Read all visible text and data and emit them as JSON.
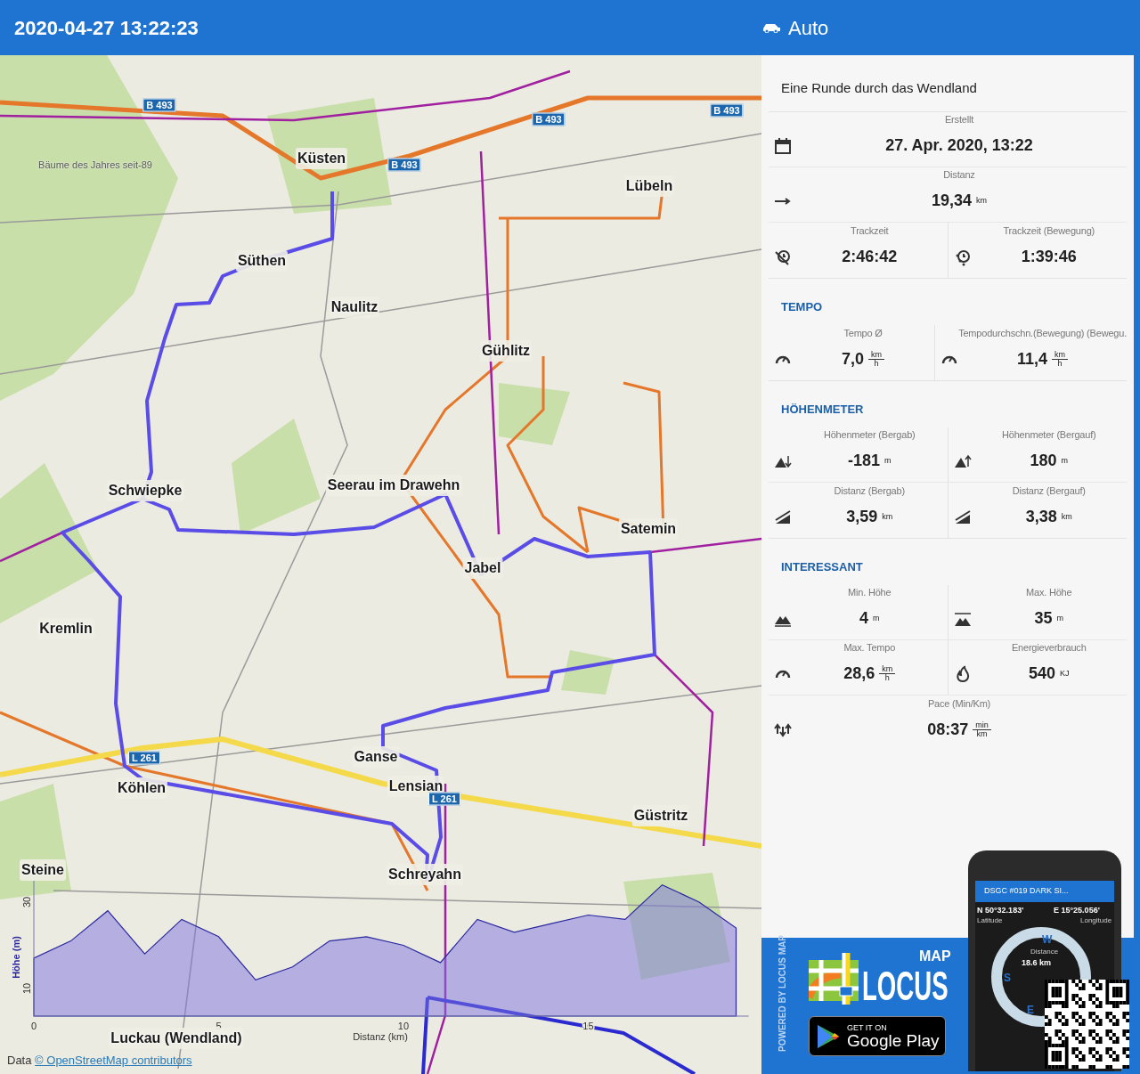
{
  "header": {
    "timestamp": "2020-04-27 13:22:23",
    "activity": "Auto"
  },
  "map": {
    "places": [
      {
        "text": "Küsten",
        "kind": "place"
      },
      {
        "text": "Lübeln",
        "kind": "place"
      },
      {
        "text": "Süthen",
        "kind": "place"
      },
      {
        "text": "Naulitz",
        "kind": "place"
      },
      {
        "text": "Gühlitz",
        "kind": "place"
      },
      {
        "text": "Schwiepke",
        "kind": "place"
      },
      {
        "text": "Seerau im Drawehn",
        "kind": "place"
      },
      {
        "text": "Jabel",
        "kind": "place"
      },
      {
        "text": "Satemin",
        "kind": "place"
      },
      {
        "text": "Kremlin",
        "kind": "place"
      },
      {
        "text": "Ganse",
        "kind": "place"
      },
      {
        "text": "Lensian",
        "kind": "place"
      },
      {
        "text": "Köhlen",
        "kind": "place"
      },
      {
        "text": "Güstritz",
        "kind": "place"
      },
      {
        "text": "Steine",
        "kind": "place"
      },
      {
        "text": "Schreyahn",
        "kind": "place"
      },
      {
        "text": "Luckau (Wendland)",
        "kind": "place"
      },
      {
        "text": "B 493",
        "kind": "road"
      },
      {
        "text": "B 493",
        "kind": "road"
      },
      {
        "text": "B 493",
        "kind": "road"
      },
      {
        "text": "B 493",
        "kind": "road"
      },
      {
        "text": "L 261",
        "kind": "road"
      },
      {
        "text": "L 261",
        "kind": "road"
      },
      {
        "text": "Bäume des Jahres seit-89",
        "kind": "note"
      }
    ],
    "attribution": {
      "prefix": "Data",
      "link": "© OpenStreetMap contributors"
    },
    "chart_data": {
      "type": "area",
      "xlabel": "Distanz (km)",
      "ylabel": "Höhe (m)",
      "x": [
        0,
        1,
        2,
        3,
        4,
        5,
        6,
        7,
        8,
        9,
        10,
        11,
        12,
        13,
        14,
        15,
        16,
        17,
        18,
        19
      ],
      "series": [
        {
          "color": "#7b74e0",
          "values": [
            17,
            21,
            28,
            18,
            26,
            22,
            12,
            15,
            21,
            22,
            20,
            16,
            26,
            23,
            25,
            27,
            26,
            34,
            30,
            24
          ]
        }
      ],
      "xlim": [
        0,
        19.34
      ],
      "ylim": [
        3.6,
        35
      ],
      "xticks": [
        0,
        5,
        10,
        15
      ],
      "yticks": [
        10,
        30
      ]
    }
  },
  "track": {
    "name": "Eine Runde durch das Wendland",
    "sections": [
      {
        "rows": [
          [
            {
              "label": "Erstellt",
              "value": "27. Apr. 2020, 13:22"
            }
          ],
          [
            {
              "label": "Distanz",
              "value": "19,34",
              "unit": "km"
            }
          ],
          [
            {
              "label": "Trackzeit",
              "value": "2:46:42"
            },
            {
              "label": "Trackzeit (Bewegung)",
              "value": "1:39:46"
            }
          ]
        ]
      },
      {
        "heading": "TEMPO",
        "rows": [
          [
            {
              "label": "Tempo Ø",
              "value": "7,0",
              "unit_over": "km",
              "unit_under": "h"
            },
            {
              "label": "Tempodurchschn.(Bewegung) (Bewegu.",
              "value": "11,4",
              "unit_over": "km",
              "unit_under": "h"
            }
          ]
        ]
      },
      {
        "heading": "HÖHENMETER",
        "rows": [
          [
            {
              "label": "Höhenmeter (Bergab)",
              "value": "-181",
              "unit": "m"
            },
            {
              "label": "Höhenmeter (Bergauf)",
              "value": "180",
              "unit": "m"
            }
          ],
          [
            {
              "label": "Distanz (Bergab)",
              "value": "3,59",
              "unit": "km"
            },
            {
              "label": "Distanz (Bergauf)",
              "value": "3,38",
              "unit": "km"
            }
          ]
        ]
      },
      {
        "heading": "INTERESSANT",
        "rows": [
          [
            {
              "label": "Min. Höhe",
              "value": "4",
              "unit": "m"
            },
            {
              "label": "Max. Höhe",
              "value": "35",
              "unit": "m"
            }
          ],
          [
            {
              "label": "Max. Tempo",
              "value": "28,6",
              "unit_over": "km",
              "unit_under": "h"
            },
            {
              "label": "Energieverbrauch",
              "value": "540",
              "unit": "KJ"
            }
          ],
          [
            {
              "label": "Pace (Min/Km)",
              "value": "08:37",
              "unit_over": "min",
              "unit_under": "km"
            }
          ]
        ]
      }
    ]
  },
  "ad": {
    "powered_by": "POWERED BY LOCUS MAP",
    "logo_small": "MAP",
    "logo_big": "LOCUS",
    "store_small": "GET IT ON",
    "store_big": "Google Play",
    "phone": {
      "title": "DSGC #019 DARK SI...",
      "lat": "N 50°32.183'",
      "lat_label": "Latitude",
      "lon": "E 15°25.056'",
      "lon_label": "Longitude",
      "distance_label": "Distance",
      "distance": "18.6 km",
      "compass": [
        "W",
        "S",
        "E"
      ]
    }
  }
}
